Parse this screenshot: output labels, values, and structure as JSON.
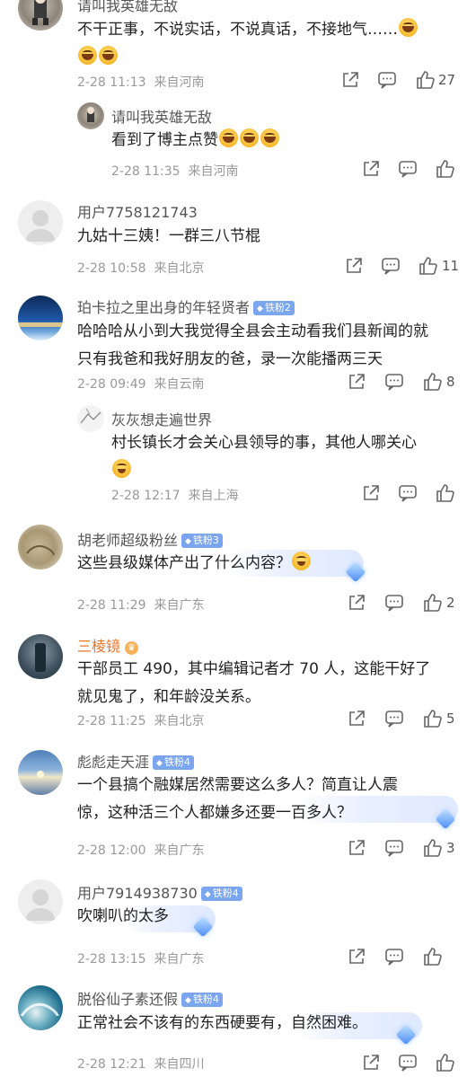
{
  "icons": {
    "share": "share-icon",
    "comment": "comment-icon",
    "like": "like-icon"
  },
  "colors": {
    "meta": "#999999",
    "text": "#222222",
    "badge": "#7aa6ef",
    "orange_name": "#e8762b"
  },
  "comments": [
    {
      "user": "请叫我英雄无敌",
      "text": "不干正事，不说实话，不说真话，不接地气……",
      "date": "2-28 11:13",
      "location": "来自河南",
      "likes": "27"
    },
    {
      "user": "请叫我英雄无敌",
      "text": "看到了博主点赞",
      "date": "2-28 11:35",
      "location": "来自河南",
      "likes": ""
    },
    {
      "user": "用户7758121743",
      "text": "九姑十三姨！一群三八节棍",
      "date": "2-28 10:58",
      "location": "来自北京",
      "likes": "11"
    },
    {
      "user": "珀卡拉之里出身的年轻贤者",
      "badge": "铁粉2",
      "text_line1": "哈哈哈从小到大我觉得全县会主动看我们县新闻的就",
      "text_line2": "只有我爸和我好朋友的爸，录一次能播两三天",
      "date": "2-28 09:49",
      "location": "来自云南",
      "likes": "8"
    },
    {
      "user": "灰灰想走遍世界",
      "text": "村长镇长才会关心县领导的事，其他人哪关心",
      "date": "2-28 12:17",
      "location": "来自上海",
      "likes": ""
    },
    {
      "user": "胡老师超级粉丝",
      "badge": "铁粉3",
      "text": "这些县级媒体产出了什么内容？",
      "date": "2-28 11:29",
      "location": "来自广东",
      "likes": "2"
    },
    {
      "user": "三棱镜",
      "text_line1": "干部员工 490，其中编辑记者才 70 人，这能干好了",
      "text_line2": "就见鬼了，和年龄没关系。",
      "date": "2-28 11:25",
      "location": "来自北京",
      "likes": "5"
    },
    {
      "user": "彪彪走天涯",
      "badge": "铁粉4",
      "text_line1": "一个县搞个融媒居然需要这么多人？简直让人震",
      "text_line2": "惊，这种活三个人都嫌多还要一百多人？",
      "date": "2-28 12:00",
      "location": "来自广东",
      "likes": "3"
    },
    {
      "user": "用户7914938730",
      "badge": "铁粉4",
      "text": "吹喇叭的太多",
      "date": "2-28 13:15",
      "location": "来自广东",
      "likes": ""
    },
    {
      "user": "脱俗仙子素还假",
      "badge": "铁粉4",
      "text": "正常社会不该有的东西硬要有，自然困难。",
      "date": "2-28 12:21",
      "location": "来自四川",
      "likes": ""
    }
  ]
}
